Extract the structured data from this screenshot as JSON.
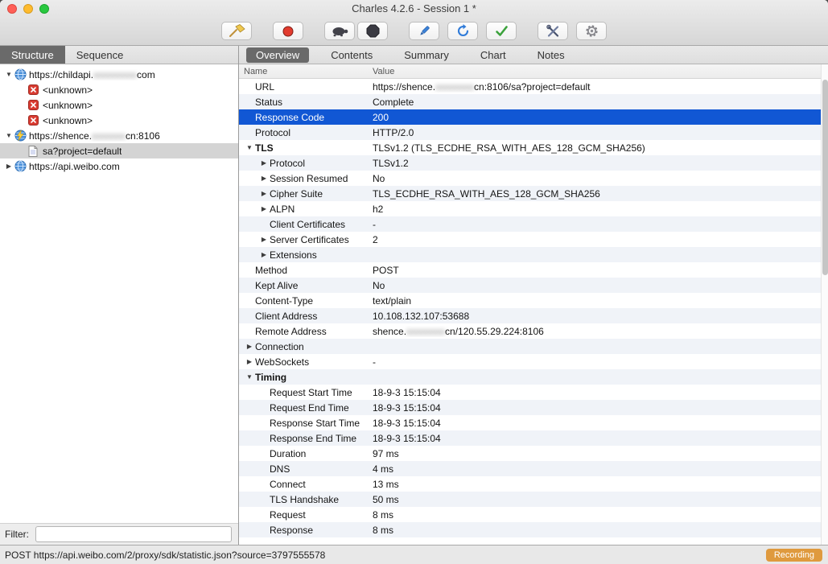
{
  "window": {
    "title": "Charles 4.2.6 - Session 1 *"
  },
  "toolbar": {
    "buttons": [
      {
        "action": "clear-session",
        "icon": "broom"
      },
      {
        "action": "record-toggle",
        "icon": "record"
      },
      {
        "action": "throttling",
        "icon": "turtle"
      },
      {
        "action": "breakpoints",
        "icon": "stop-octagon"
      },
      {
        "action": "compose",
        "icon": "pencil"
      },
      {
        "action": "repeat",
        "icon": "repeat-arrow"
      },
      {
        "action": "validate",
        "icon": "checkmark"
      },
      {
        "action": "tools",
        "icon": "crossed-tools"
      },
      {
        "action": "settings",
        "icon": "gear"
      }
    ]
  },
  "sidebar": {
    "tabs": [
      {
        "label": "Structure",
        "active": true
      },
      {
        "label": "Sequence",
        "active": false
      }
    ],
    "tree": [
      {
        "indent": 0,
        "expander": "expanded",
        "icon": "globe",
        "parts": [
          {
            "text": "https://childapi.",
            "blur": false
          },
          {
            "text": "xxxxxxxxx",
            "blur": true
          },
          {
            "text": "com",
            "blur": false
          }
        ]
      },
      {
        "indent": 1,
        "expander": "",
        "icon": "error-x",
        "parts": [
          {
            "text": "<unknown>",
            "blur": false
          }
        ]
      },
      {
        "indent": 1,
        "expander": "",
        "icon": "error-x",
        "parts": [
          {
            "text": "<unknown>",
            "blur": false
          }
        ]
      },
      {
        "indent": 1,
        "expander": "",
        "icon": "error-x",
        "parts": [
          {
            "text": "<unknown>",
            "blur": false
          }
        ]
      },
      {
        "indent": 0,
        "expander": "expanded",
        "icon": "globe-lightning",
        "parts": [
          {
            "text": "https://shence.",
            "blur": false
          },
          {
            "text": "xxxxxxx",
            "blur": true
          },
          {
            "text": "cn:8106",
            "blur": false
          }
        ]
      },
      {
        "indent": 1,
        "expander": "",
        "icon": "document",
        "selected": true,
        "parts": [
          {
            "text": "sa?project=default",
            "blur": false
          }
        ]
      },
      {
        "indent": 0,
        "expander": "collapsed",
        "icon": "globe",
        "parts": [
          {
            "text": "https://api.weibo.com",
            "blur": false
          }
        ]
      }
    ],
    "filter": {
      "label": "Filter:",
      "value": ""
    }
  },
  "main": {
    "tabs": [
      {
        "label": "Overview",
        "active": true
      },
      {
        "label": "Contents",
        "active": false
      },
      {
        "label": "Summary",
        "active": false
      },
      {
        "label": "Chart",
        "active": false
      },
      {
        "label": "Notes",
        "active": false
      }
    ],
    "columns": [
      "Name",
      "Value"
    ],
    "rows": [
      {
        "name": "URL",
        "value_parts": [
          {
            "text": "https://shence.",
            "blur": false
          },
          {
            "text": "xxxxxxxx",
            "blur": true
          },
          {
            "text": "cn:8106/sa?project=default",
            "blur": false
          }
        ]
      },
      {
        "name": "Status",
        "value": "Complete"
      },
      {
        "name": "Response Code",
        "value": "200",
        "selected": true
      },
      {
        "name": "Protocol",
        "value": "HTTP/2.0"
      },
      {
        "name": "TLS",
        "bold": true,
        "expander": "expanded",
        "value": "TLSv1.2 (TLS_ECDHE_RSA_WITH_AES_128_GCM_SHA256)"
      },
      {
        "name": "Protocol",
        "indent": 1,
        "expander": "collapsed",
        "value": "TLSv1.2"
      },
      {
        "name": "Session Resumed",
        "indent": 1,
        "expander": "collapsed",
        "value": "No"
      },
      {
        "name": "Cipher Suite",
        "indent": 1,
        "expander": "collapsed",
        "value": "TLS_ECDHE_RSA_WITH_AES_128_GCM_SHA256"
      },
      {
        "name": "ALPN",
        "indent": 1,
        "expander": "collapsed",
        "value": "h2"
      },
      {
        "name": "Client Certificates",
        "indent": 1,
        "value": "-"
      },
      {
        "name": "Server Certificates",
        "indent": 1,
        "expander": "collapsed",
        "value": "2"
      },
      {
        "name": "Extensions",
        "indent": 1,
        "expander": "collapsed",
        "value": ""
      },
      {
        "name": "Method",
        "value": "POST"
      },
      {
        "name": "Kept Alive",
        "value": "No"
      },
      {
        "name": "Content-Type",
        "value": "text/plain"
      },
      {
        "name": "Client Address",
        "value": "10.108.132.107:53688"
      },
      {
        "name": "Remote Address",
        "value_parts": [
          {
            "text": "shence.",
            "blur": false
          },
          {
            "text": "xxxxxxxx",
            "blur": true
          },
          {
            "text": "cn/120.55.29.224:8106",
            "blur": false
          }
        ]
      },
      {
        "name": "Connection",
        "expander": "collapsed",
        "value": ""
      },
      {
        "name": "WebSockets",
        "expander": "collapsed",
        "value": "-"
      },
      {
        "name": "Timing",
        "bold": true,
        "expander": "expanded",
        "value": ""
      },
      {
        "name": "Request Start Time",
        "indent": 1,
        "value": "18-9-3 15:15:04"
      },
      {
        "name": "Request End Time",
        "indent": 1,
        "value": "18-9-3 15:15:04"
      },
      {
        "name": "Response Start Time",
        "indent": 1,
        "value": "18-9-3 15:15:04"
      },
      {
        "name": "Response End Time",
        "indent": 1,
        "value": "18-9-3 15:15:04"
      },
      {
        "name": "Duration",
        "indent": 1,
        "value": "97 ms"
      },
      {
        "name": "DNS",
        "indent": 1,
        "value": "4 ms"
      },
      {
        "name": "Connect",
        "indent": 1,
        "value": "13 ms"
      },
      {
        "name": "TLS Handshake",
        "indent": 1,
        "value": "50 ms"
      },
      {
        "name": "Request",
        "indent": 1,
        "value": "8 ms"
      },
      {
        "name": "Response",
        "indent": 1,
        "value": "8 ms"
      }
    ]
  },
  "statusbar": {
    "text": "POST https://api.weibo.com/2/proxy/sdk/statistic.json?source=3797555578",
    "recording": "Recording"
  },
  "colors": {
    "selection_blue": "#1157d4",
    "recording_badge": "#df9a3e",
    "record_red": "#e23b2e"
  }
}
